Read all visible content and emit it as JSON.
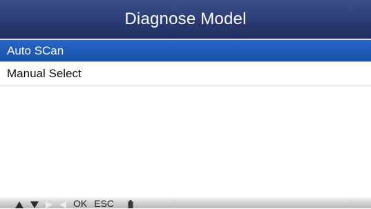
{
  "header": {
    "title": "Diagnose Model"
  },
  "menu": {
    "items": [
      {
        "label": "Auto SCan",
        "selected": true
      },
      {
        "label": "Manual Select",
        "selected": false
      }
    ]
  },
  "footer": {
    "keys": [
      {
        "icon": "up-arrow-icon"
      },
      {
        "icon": "down-arrow-icon"
      },
      {
        "icon": "right-arrow-icon"
      },
      {
        "icon": "left-arrow-icon"
      },
      {
        "label": "OK"
      },
      {
        "label": "ESC"
      },
      {
        "icon": "battery-icon"
      }
    ]
  },
  "colors": {
    "title_bar": "#2b3b73",
    "selected_row": "#1e5ab5",
    "footer_bar": "#d2d2d2"
  }
}
